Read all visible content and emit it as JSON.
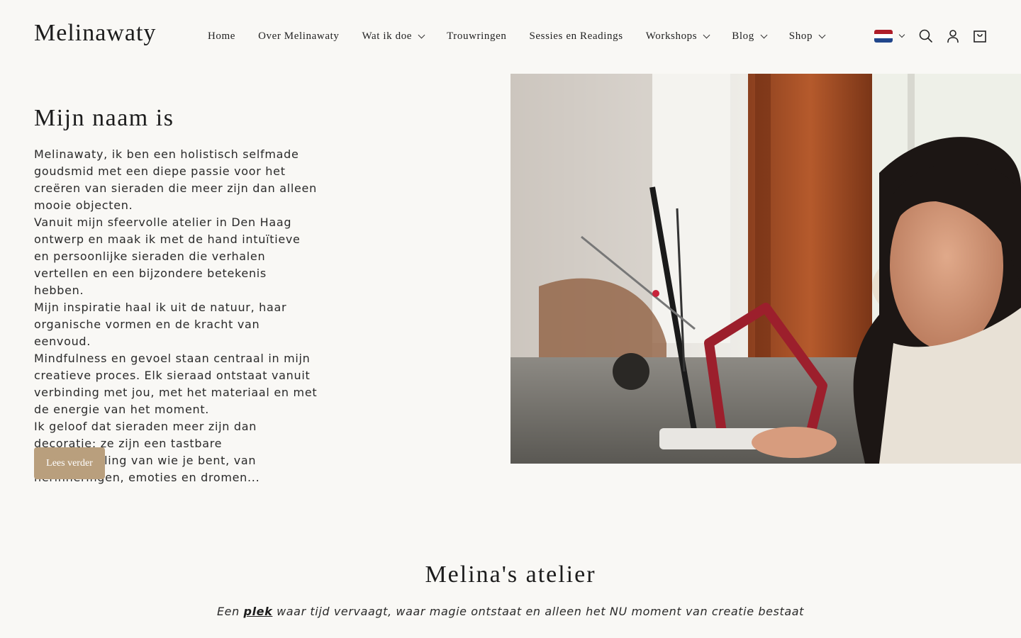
{
  "header": {
    "logo": "Melinawaty",
    "nav": [
      {
        "label": "Home",
        "dropdown": false
      },
      {
        "label": "Over Melinawaty",
        "dropdown": false
      },
      {
        "label": "Wat ik doe",
        "dropdown": true
      },
      {
        "label": "Trouwringen",
        "dropdown": false
      },
      {
        "label": "Sessies en Readings",
        "dropdown": false
      },
      {
        "label": "Workshops",
        "dropdown": true
      },
      {
        "label": "Blog",
        "dropdown": true
      },
      {
        "label": "Shop",
        "dropdown": true
      }
    ],
    "utilities": {
      "language_flag": "netherlands-flag",
      "flag_colors": [
        "#ae1c28",
        "#ffffff",
        "#21468b"
      ],
      "icons": [
        "search-icon",
        "account-icon",
        "cart-icon"
      ]
    }
  },
  "about": {
    "heading": "Mijn naam is",
    "paragraphs": [
      "Melinawaty, ik ben een holistisch selfmade goudsmid met een diepe passie voor het creëren van sieraden die meer zijn dan alleen mooie objecten.",
      "Vanuit mijn sfeervolle atelier in Den Haag ontwerp en maak ik met de hand intuïtieve en persoonlijke sieraden die verhalen vertellen en een bijzondere betekenis hebben.",
      "Mijn inspiratie haal ik uit de natuur, haar organische vormen en de kracht van eenvoud.",
      "Mindfulness en gevoel staan centraal in mijn creatieve proces. Elk sieraad ontstaat vanuit verbinding met jou, met het materiaal en met de energie van het moment.",
      "Ik geloof dat sieraden meer zijn dan decoratie; ze zijn een tastbare weerspiegeling van wie je bent, van herinneringen, emoties en dromen..."
    ],
    "button_label": "Lees verder",
    "button_color": "#b99f7d"
  },
  "atelier": {
    "title": "Melina's atelier",
    "subtitle_before": "Een ",
    "subtitle_link": "plek",
    "subtitle_after": " waar tijd vervaagt, waar magie ontstaat en alleen het NU moment van creatie bestaat"
  }
}
